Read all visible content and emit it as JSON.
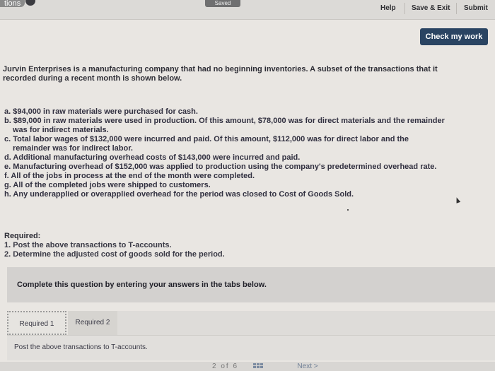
{
  "header": {
    "tab_fragment": "tions",
    "saved_label": "Saved",
    "help_label": "Help",
    "save_exit_label": "Save & Exit",
    "submit_label": "Submit"
  },
  "check_button": "Check my work",
  "intro_line1": "Jurvin Enterprises is a manufacturing company that had no beginning inventories. A subset of the transactions that it",
  "intro_line2": "recorded during a recent month is shown below.",
  "transactions": {
    "a": "a. $94,000 in raw materials were purchased for cash.",
    "b1": "b. $89,000 in raw materials were used in production. Of this amount, $78,000 was for direct materials and the remainder",
    "b2": "was for indirect materials.",
    "c1": "c. Total labor wages of $132,000 were incurred and paid. Of this amount, $112,000 was for direct labor and the",
    "c2": "remainder was for indirect labor.",
    "d": "d. Additional manufacturing overhead costs of $143,000 were incurred and paid.",
    "e": "e. Manufacturing overhead of $152,000 was applied to production using the company's predetermined overhead rate.",
    "f": "f. All of the jobs in process at the end of the month were completed.",
    "g": "g. All of the completed jobs were shipped to customers.",
    "h": "h. Any underapplied or overapplied overhead for the period was closed to Cost of Goods Sold."
  },
  "required": {
    "title": "Required:",
    "item1": "1. Post the above transactions to T-accounts.",
    "item2": "2. Determine the adjusted cost of goods sold for the period."
  },
  "complete_prompt": "Complete this question by entering your answers in the tabs below.",
  "tabs": {
    "required1": "Required 1",
    "required2": "Required 2"
  },
  "panel_text": "Post the above transactions to T-accounts.",
  "footer": {
    "pager": "2 of 6",
    "next_label": "Next  >"
  }
}
